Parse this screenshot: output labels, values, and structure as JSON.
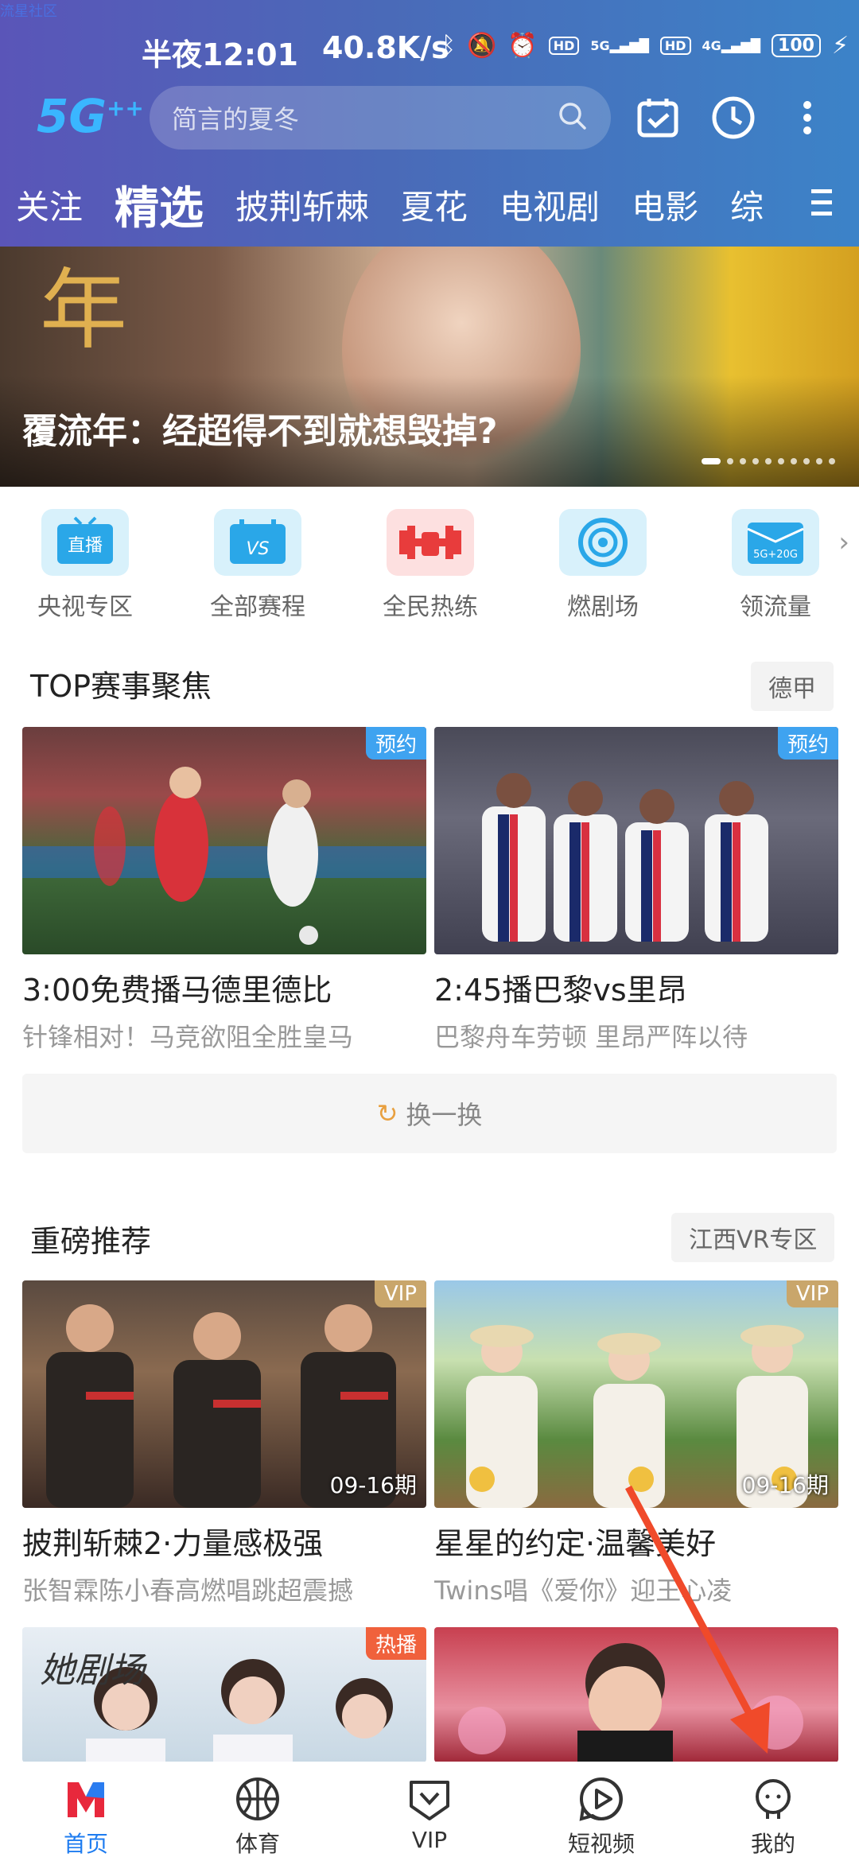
{
  "watermark": "流星社区",
  "status_bar": {
    "time": "半夜12:01",
    "net_speed": "40.8K/s",
    "hd1": "HD",
    "sig1": "5G",
    "hd2": "HD",
    "sig2": "4G",
    "battery": "100"
  },
  "header": {
    "logo": "5G",
    "logo_sup": "++",
    "search_placeholder": "简言的夏冬"
  },
  "tabs": [
    "关注",
    "精选",
    "披荆斩棘",
    "夏花",
    "电视剧",
    "电影",
    "综"
  ],
  "active_tab": 1,
  "banner": {
    "year_text": "年",
    "caption": "覆流年：经超得不到就想毁掉?",
    "dot_count": 10
  },
  "quick_links": [
    {
      "label": "央视专区",
      "icon_text": "直播",
      "color": "#2aa7e8",
      "bg": "#d8f1fb"
    },
    {
      "label": "全部赛程",
      "icon_text": "VS",
      "color": "#2aa7e8",
      "bg": "#d8f1fb"
    },
    {
      "label": "全民热练",
      "icon_text": "",
      "color": "#e83c3c",
      "bg": "#fde0e0"
    },
    {
      "label": "燃剧场",
      "icon_text": "",
      "color": "#2aa7e8",
      "bg": "#d8f1fb"
    },
    {
      "label": "领流量",
      "icon_text": "5G+20G",
      "color": "#2aa7e8",
      "bg": "#d8f1fb"
    }
  ],
  "section1": {
    "title": "TOP赛事聚焦",
    "tag": "德甲",
    "cards": [
      {
        "badge": "预约",
        "title": "3:00免费播马德里德比",
        "subtitle": "针锋相对！马竞欲阻全胜皇马"
      },
      {
        "badge": "预约",
        "title": "2:45播巴黎vs里昂",
        "subtitle": "巴黎舟车劳顿 里昂严阵以待"
      }
    ],
    "refresh_label": "换一换"
  },
  "section2": {
    "title": "重磅推荐",
    "tag": "江西VR专区",
    "cards": [
      {
        "badge": "VIP",
        "episode": "09-16期",
        "title": "披荆斩棘2·力量感极强",
        "subtitle": "张智霖陈小春高燃唱跳超震撼"
      },
      {
        "badge": "VIP",
        "episode": "09-16期",
        "title": "星星的约定·温馨美好",
        "subtitle": "Twins唱《爱你》迎王心凌"
      }
    ]
  },
  "section3": {
    "cards": [
      {
        "badge": "热播",
        "overlay": "她剧场"
      },
      {
        "badge": "",
        "overlay": ""
      }
    ]
  },
  "bottom_nav": [
    {
      "label": "首页",
      "icon": "home-icon",
      "active": true
    },
    {
      "label": "体育",
      "icon": "basketball-icon",
      "active": false
    },
    {
      "label": "VIP",
      "icon": "vip-icon",
      "active": false
    },
    {
      "label": "短视频",
      "icon": "play-icon",
      "active": false
    },
    {
      "label": "我的",
      "icon": "profile-icon",
      "active": false
    }
  ],
  "colors": {
    "header_start": "#5a55b8",
    "header_end": "#3c83c8",
    "accent_blue": "#1e7cf0",
    "badge_blue": "#3fa3f0",
    "badge_vip": "#c9a66b",
    "badge_hot": "#f0613c",
    "annotation_arrow": "#f04a2a"
  }
}
